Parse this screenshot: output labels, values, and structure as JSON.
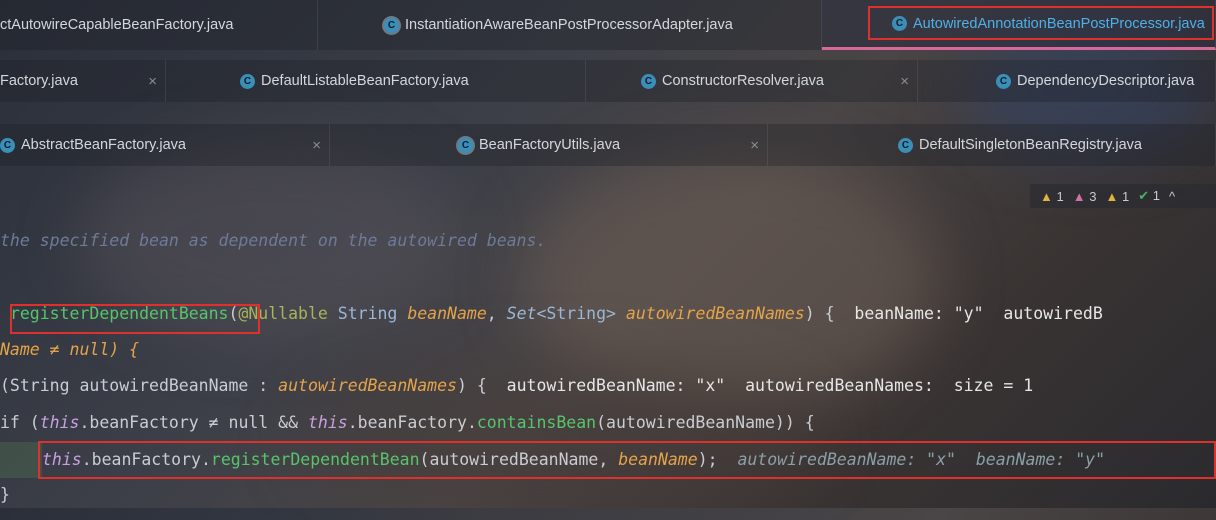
{
  "tabs": {
    "row1": [
      {
        "label": "ctAutowireCapableBeanFactory.java",
        "icon": null
      },
      {
        "label": "InstantiationAwareBeanPostProcessorAdapter.java",
        "icon": "class-icon"
      },
      {
        "label": "AutowiredAnnotationBeanPostProcessor.java",
        "icon": "class-icon",
        "active": true
      }
    ],
    "row2": [
      {
        "label": "Factory.java",
        "icon": null
      },
      {
        "label": "DefaultListableBeanFactory.java",
        "icon": "class-icon"
      },
      {
        "label": "ConstructorResolver.java",
        "icon": "class-icon"
      },
      {
        "label": "DependencyDescriptor.java",
        "icon": "class-icon"
      }
    ],
    "row3": [
      {
        "label": "AbstractBeanFactory.java",
        "icon": "class-icon"
      },
      {
        "label": "BeanFactoryUtils.java",
        "icon": "class-icon"
      },
      {
        "label": "DefaultSingletonBeanRegistry.java",
        "icon": "class-icon"
      }
    ],
    "close_glyph": "×",
    "class_glyph": "C"
  },
  "inspections": {
    "warn1": "1",
    "weak_warn": "3",
    "warn2": "1",
    "ok": "1",
    "collapse_glyph": "^"
  },
  "code": {
    "comment": "the specified bean as dependent on the autowired beans.",
    "method_name": "registerDependentBeans",
    "annotation": "@Nullable",
    "string_type": "String",
    "bean_name": "beanName",
    "set_type": "Set",
    "generic": "<String>",
    "autowired_bean_names": "autowiredBeanNames",
    "open_brace": ") {",
    "hint_line1_name": "beanName: \"y\"",
    "hint_line1_names": "autowiredB",
    "line2": "Name ≠ null) {",
    "line3_for": "(String autowiredBeanName : ",
    "line3_rest": ") {",
    "hint_line3_a": "autowiredBeanName: \"x\"",
    "hint_line3_b": "autowiredBeanNames:  size = 1",
    "line4_if": "if (",
    "this_kw": "this",
    "line4_mid": ".beanFactory ≠ null && ",
    "line4_mid2": ".beanFactory.",
    "contains_bean": "containsBean",
    "line4_end": "(autowiredBeanName)) {",
    "line5_mid": ".beanFactory.",
    "register_bean": "registerDependentBean",
    "line5_args": "(autowiredBeanName, ",
    "line5_end": ");",
    "hint_line5_a": "autowiredBeanName: \"x\"",
    "hint_line5_b": "beanName: \"y\"",
    "line6": "}"
  },
  "colors": {
    "highlight_border": "#e0302b",
    "active_tab_text": "#4fb0e6",
    "active_tab_underline": "#d9689a"
  }
}
